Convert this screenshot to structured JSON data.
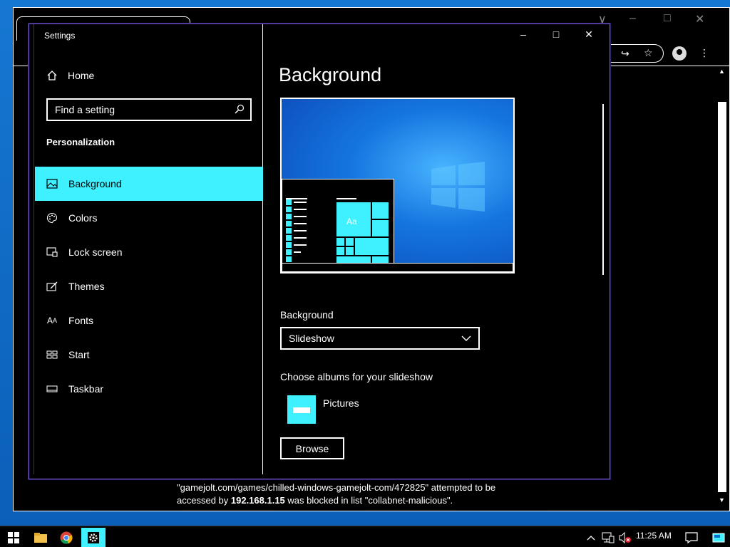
{
  "settings": {
    "window_title": "Settings",
    "controls": {
      "minimize": "–",
      "maximize": "□",
      "close": "✕"
    },
    "nav": {
      "home_label": "Home",
      "search_placeholder": "Find a setting",
      "section_title": "Personalization",
      "items": [
        {
          "label": "Background",
          "icon": "picture-icon",
          "active": true
        },
        {
          "label": "Colors",
          "icon": "palette-icon",
          "active": false
        },
        {
          "label": "Lock screen",
          "icon": "lock-screen-icon",
          "active": false
        },
        {
          "label": "Themes",
          "icon": "themes-icon",
          "active": false
        },
        {
          "label": "Fonts",
          "icon": "fonts-icon",
          "active": false
        },
        {
          "label": "Start",
          "icon": "start-icon",
          "active": false
        },
        {
          "label": "Taskbar",
          "icon": "taskbar-icon",
          "active": false
        }
      ]
    },
    "content": {
      "page_title": "Background",
      "preview_sample_text": "Aa",
      "background_label": "Background",
      "background_value": "Slideshow",
      "albums_label": "Choose albums for your slideshow",
      "album_name": "Pictures",
      "browse_label": "Browse"
    }
  },
  "browser": {
    "block_message_part1": "\"gamejolt.com/games/chilled-windows-gamejolt-com/472825\" attempted to be accessed by ",
    "block_message_ip": "192.168.1.15",
    "block_message_part2": " was blocked in list \"collabnet-malicious\"."
  },
  "taskbar": {
    "time": "11:25 AM",
    "accent_color": "#3ff0ff"
  }
}
